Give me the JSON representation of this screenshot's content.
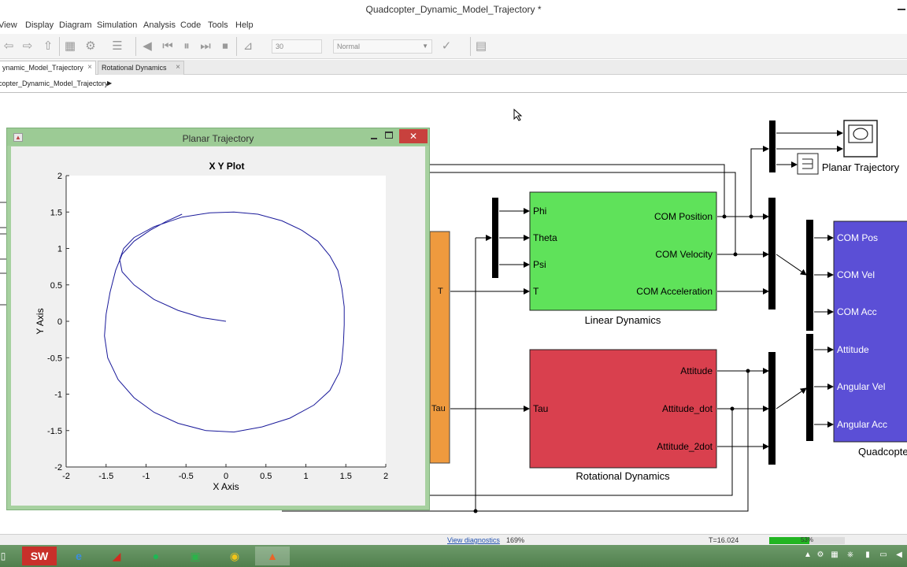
{
  "window": {
    "title": "Quadcopter_Dynamic_Model_Trajectory *"
  },
  "menu": [
    "View",
    "Display",
    "Diagram",
    "Simulation",
    "Analysis",
    "Code",
    "Tools",
    "Help"
  ],
  "toolbar": {
    "stop_time": "30",
    "sim_mode": "Normal"
  },
  "tabs": [
    {
      "label": "ynamic_Model_Trajectory",
      "active": true
    },
    {
      "label": "Rotational Dynamics",
      "active": false
    }
  ],
  "breadcrumb": "copter_Dynamic_Model_Trajectory",
  "blocks": {
    "linear": {
      "name": "Linear Dynamics",
      "inputs": [
        "Phi",
        "Theta",
        "Psi",
        "T"
      ],
      "outputs": [
        "COM Position",
        "COM Velocity",
        "COM Acceleration"
      ],
      "color": "#5fe25a"
    },
    "rotational": {
      "name": "Rotational Dynamics",
      "inputs": [
        "Tau"
      ],
      "outputs": [
        "Attitude",
        "Attitude_dot",
        "Attitude_2dot"
      ],
      "color": "#d9404e"
    },
    "controller": {
      "outputs": [
        "T",
        "Tau"
      ],
      "color": "#ef9a3e"
    },
    "quad": {
      "name": "Quadcopte",
      "inputs": [
        "COM Pos",
        "COM Vel",
        "COM Acc",
        "Attitude",
        "Angular Vel",
        "Angular Acc"
      ],
      "color": "#5b4fd6"
    },
    "scope": {
      "name": "Planar Trajectory"
    }
  },
  "figure": {
    "title": "Planar  Trajectory"
  },
  "chart_data": {
    "type": "line",
    "title": "X Y Plot",
    "xlabel": "X Axis",
    "ylabel": "Y Axis",
    "xlim": [
      -2,
      2
    ],
    "ylim": [
      -2,
      2
    ],
    "xticks": [
      "-2",
      "-1.5",
      "-1",
      "-0.5",
      "0",
      "0.5",
      "1",
      "1.5",
      "2"
    ],
    "yticks": [
      "2",
      "1.5",
      "1",
      "0.5",
      "0",
      "-0.5",
      "-1",
      "-1.5",
      "-2"
    ],
    "grid": false,
    "series": [
      {
        "color": "#1a1a9a",
        "x": [
          0,
          -0.3,
          -0.6,
          -0.9,
          -1.15,
          -1.3,
          -1.33,
          -1.28,
          -1.15,
          -0.9,
          -0.55,
          -0.2,
          0.1,
          0.4,
          0.7,
          0.95,
          1.15,
          1.3,
          1.4,
          1.45,
          1.48,
          1.48,
          1.47,
          1.45,
          1.42,
          1.3,
          1.1,
          0.8,
          0.45,
          0.1,
          -0.25,
          -0.6,
          -0.9,
          -1.15,
          -1.35,
          -1.48,
          -1.52,
          -1.5,
          -1.45,
          -1.38,
          -1.3,
          -1.15,
          -0.95,
          -0.75,
          -0.55
        ],
        "y": [
          0,
          0.05,
          0.15,
          0.3,
          0.5,
          0.68,
          0.85,
          1.0,
          1.15,
          1.3,
          1.43,
          1.49,
          1.5,
          1.47,
          1.38,
          1.25,
          1.1,
          0.9,
          0.7,
          0.45,
          0.2,
          -0.05,
          -0.3,
          -0.55,
          -0.7,
          -0.95,
          -1.15,
          -1.33,
          -1.45,
          -1.52,
          -1.5,
          -1.4,
          -1.25,
          -1.05,
          -0.8,
          -0.5,
          -0.2,
          0.1,
          0.4,
          0.7,
          0.92,
          1.1,
          1.25,
          1.37,
          1.47
        ]
      }
    ]
  },
  "status": {
    "diagnostics": "View diagnostics",
    "zoom": "169%",
    "time": "T=16.024",
    "progress_label": "53%",
    "progress": 53
  }
}
